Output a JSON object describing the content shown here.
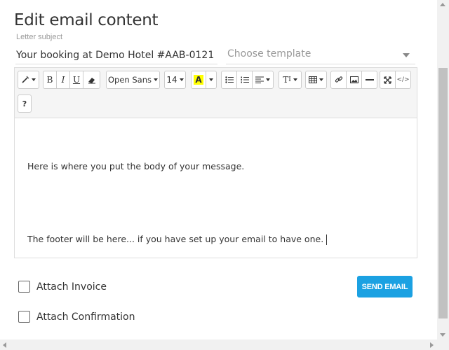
{
  "dialog": {
    "title": "Edit email content"
  },
  "subject": {
    "label": "Letter subject",
    "value": "Your booking at Demo Hotel #AAB-0121"
  },
  "template": {
    "placeholder": "Choose template"
  },
  "toolbar": {
    "font_family": "Open Sans",
    "font_size": "14",
    "bold": "B",
    "italic": "I",
    "underline": "U",
    "font_color": "A",
    "text_size": "T",
    "help": "?",
    "code": "</>"
  },
  "body": {
    "line1": "Here is where you put the body of your message.",
    "line2": "The footer will be here... if you have set up your email to have one."
  },
  "options": {
    "attach_invoice": "Attach Invoice",
    "attach_confirmation": "Attach Confirmation"
  },
  "actions": {
    "send_label": "SEND EMAIL"
  },
  "colors": {
    "accent": "#1ba1e2",
    "highlight": "#ffff00"
  }
}
